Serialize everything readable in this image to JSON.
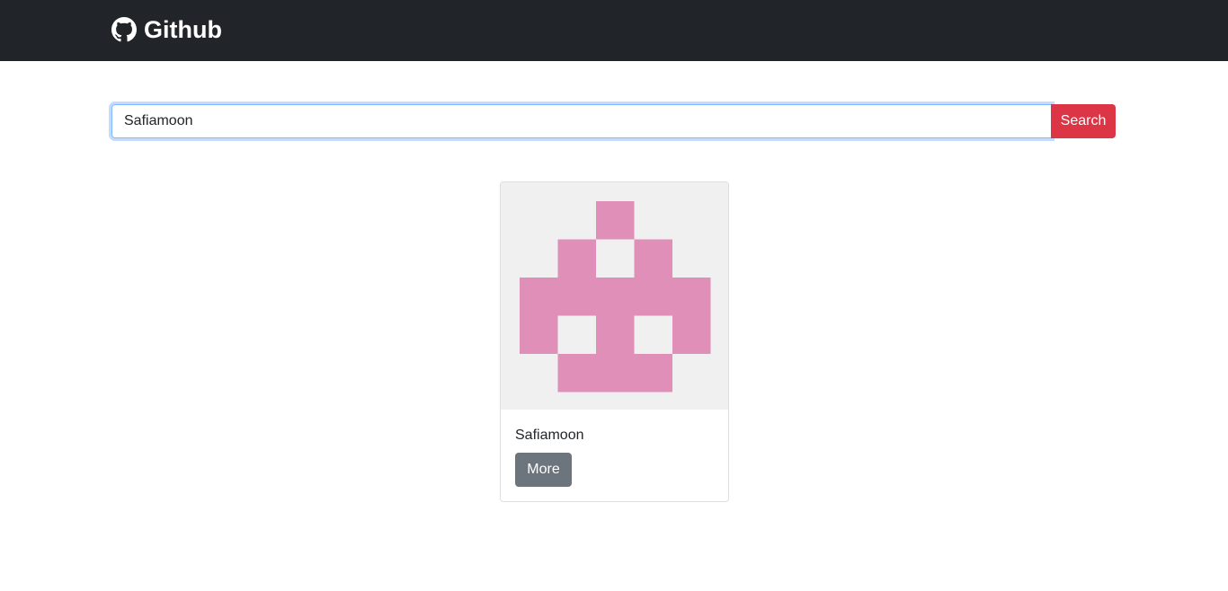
{
  "navbar": {
    "brand_label": "Github",
    "brand_icon": "github-icon"
  },
  "search": {
    "value": "Safiamoon",
    "button_label": "Search"
  },
  "results": [
    {
      "username": "Safiamoon",
      "avatar_icon": "identicon-avatar",
      "avatar_color": "#e08fb8",
      "avatar_bg": "#f0f0f0",
      "button_label": "More"
    }
  ]
}
